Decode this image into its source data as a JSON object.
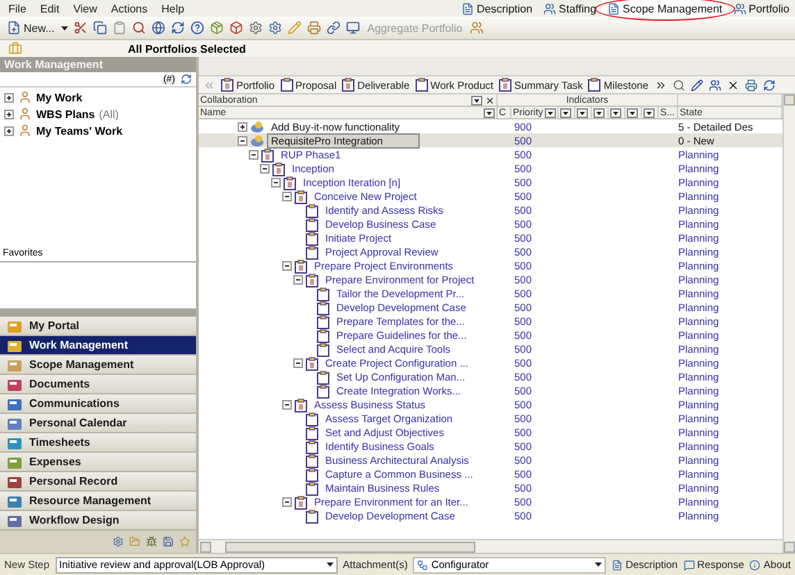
{
  "menu": [
    {
      "label": "File"
    },
    {
      "label": "Edit"
    },
    {
      "label": "View"
    },
    {
      "label": "Actions"
    },
    {
      "label": "Help"
    }
  ],
  "view_tabs": [
    {
      "label": "Description",
      "selected": false,
      "highlighted": false
    },
    {
      "label": "Staffing",
      "selected": false,
      "highlighted": false
    },
    {
      "label": "Scope Management",
      "selected": true,
      "highlighted": true
    },
    {
      "label": "Portfolio",
      "selected": false,
      "highlighted": false
    }
  ],
  "toolbar": {
    "new_button": "New...",
    "aggregate_portfolio": {
      "label": "Aggregate Portfolio",
      "disabled": true
    }
  },
  "portfolio_bar": {
    "title": "All Portfolios Selected"
  },
  "left_panel": {
    "title": "Work Management",
    "count_button": "(#)",
    "tree": [
      {
        "label": "My Work",
        "expanded": false
      },
      {
        "label": "WBS Plans",
        "suffix": "(All)",
        "expanded": false
      },
      {
        "label": "My Teams' Work",
        "expanded": false
      }
    ],
    "favorites_label": "Favorites",
    "nav": [
      {
        "label": "My Portal",
        "selected": false
      },
      {
        "label": "Work Management",
        "selected": true
      },
      {
        "label": "Scope Management",
        "selected": false
      },
      {
        "label": "Documents",
        "selected": false
      },
      {
        "label": "Communications",
        "selected": false
      },
      {
        "label": "Personal Calendar",
        "selected": false
      },
      {
        "label": "Timesheets",
        "selected": false
      },
      {
        "label": "Expenses",
        "selected": false
      },
      {
        "label": "Personal Record",
        "selected": false
      },
      {
        "label": "Resource Management",
        "selected": false
      },
      {
        "label": "Workflow Design",
        "selected": false
      }
    ]
  },
  "work_toolbar": [
    {
      "label": "Portfolio"
    },
    {
      "label": "Proposal"
    },
    {
      "label": "Deliverable"
    },
    {
      "label": "Work Product"
    },
    {
      "label": "Summary Task"
    },
    {
      "label": "Milestone"
    }
  ],
  "grid": {
    "group_headers": [
      "Collaboration",
      "Indicators"
    ],
    "columns": {
      "name": "Name",
      "c": "C",
      "priority": "Priority",
      "s": "S...",
      "state": "State"
    },
    "rows": [
      {
        "name": "Add Buy-it-now functionality",
        "kind": "proposal",
        "priority": "900",
        "state": "5 - Detailed Des",
        "expanded": false,
        "selected": false
      },
      {
        "name": "RequisitePro Integration",
        "kind": "proposal",
        "priority": "500",
        "state": "0 - New",
        "expanded": true,
        "selected": true,
        "children": [
          {
            "name": "RUP Phase1",
            "kind": "summary",
            "priority": "500",
            "state": "Planning",
            "expanded": true,
            "selected": false,
            "children": [
              {
                "name": "Inception",
                "kind": "summary",
                "priority": "500",
                "state": "Planning",
                "expanded": true,
                "selected": false,
                "children": [
                  {
                    "name": "Inception Iteration [n]",
                    "kind": "summary",
                    "priority": "500",
                    "state": "Planning",
                    "expanded": true,
                    "selected": false,
                    "children": [
                      {
                        "name": "Conceive New Project",
                        "kind": "summary",
                        "priority": "500",
                        "state": "Planning",
                        "expanded": true,
                        "selected": false,
                        "children": [
                          {
                            "name": "Identify and Assess Risks",
                            "kind": "task",
                            "priority": "500",
                            "state": "Planning",
                            "selected": false
                          },
                          {
                            "name": "Develop Business Case",
                            "kind": "task",
                            "priority": "500",
                            "state": "Planning",
                            "selected": false
                          },
                          {
                            "name": "Initiate Project",
                            "kind": "task",
                            "priority": "500",
                            "state": "Planning",
                            "selected": false
                          },
                          {
                            "name": "Project Approval Review",
                            "kind": "task",
                            "priority": "500",
                            "state": "Planning",
                            "selected": false
                          }
                        ]
                      },
                      {
                        "name": "Prepare Project Environments",
                        "kind": "summary",
                        "priority": "500",
                        "state": "Planning",
                        "expanded": true,
                        "selected": false,
                        "children": [
                          {
                            "name": "Prepare Environment for Project",
                            "kind": "summary",
                            "priority": "500",
                            "state": "Planning",
                            "expanded": true,
                            "selected": false,
                            "children": [
                              {
                                "name": "Tailor the Development Pr...",
                                "kind": "task",
                                "priority": "500",
                                "state": "Planning",
                                "selected": false
                              },
                              {
                                "name": "Develop Development Case",
                                "kind": "task",
                                "priority": "500",
                                "state": "Planning",
                                "selected": false
                              },
                              {
                                "name": "Prepare Templates for the...",
                                "kind": "task",
                                "priority": "500",
                                "state": "Planning",
                                "selected": false
                              },
                              {
                                "name": "Prepare Guidelines for the...",
                                "kind": "task",
                                "priority": "500",
                                "state": "Planning",
                                "selected": false
                              },
                              {
                                "name": "Select and Acquire Tools",
                                "kind": "task",
                                "priority": "500",
                                "state": "Planning",
                                "selected": false
                              }
                            ]
                          },
                          {
                            "name": "Create Project Configuration ...",
                            "kind": "summary",
                            "priority": "500",
                            "state": "Planning",
                            "expanded": true,
                            "selected": false,
                            "children": [
                              {
                                "name": "Set Up Configuration Man...",
                                "kind": "task",
                                "priority": "500",
                                "state": "Planning",
                                "selected": false
                              },
                              {
                                "name": "Create Integration Works...",
                                "kind": "task",
                                "priority": "500",
                                "state": "Planning",
                                "selected": false
                              }
                            ]
                          }
                        ]
                      },
                      {
                        "name": "Assess Business Status",
                        "kind": "summary",
                        "priority": "500",
                        "state": "Planning",
                        "expanded": true,
                        "selected": false,
                        "children": [
                          {
                            "name": "Assess Target Organization",
                            "kind": "task",
                            "priority": "500",
                            "state": "Planning",
                            "selected": false
                          },
                          {
                            "name": "Set and Adjust Objectives",
                            "kind": "task",
                            "priority": "500",
                            "state": "Planning",
                            "selected": false
                          },
                          {
                            "name": "Identify Business Goals",
                            "kind": "task",
                            "priority": "500",
                            "state": "Planning",
                            "selected": false
                          },
                          {
                            "name": "Business Architectural Analysis",
                            "kind": "task",
                            "priority": "500",
                            "state": "Planning",
                            "selected": false
                          },
                          {
                            "name": "Capture a Common Business ...",
                            "kind": "task",
                            "priority": "500",
                            "state": "Planning",
                            "selected": false
                          },
                          {
                            "name": "Maintain Business Rules",
                            "kind": "task",
                            "priority": "500",
                            "state": "Planning",
                            "selected": false
                          }
                        ]
                      },
                      {
                        "name": "Prepare Environment for an Iter...",
                        "kind": "summary",
                        "priority": "500",
                        "state": "Planning",
                        "expanded": true,
                        "selected": false,
                        "children": [
                          {
                            "name": "Develop Development Case",
                            "kind": "task",
                            "priority": "500",
                            "state": "Planning",
                            "selected": false
                          }
                        ]
                      }
                    ]
                  }
                ]
              }
            ]
          }
        ]
      }
    ]
  },
  "status_bar": {
    "new_step_label": "New Step",
    "new_step_value": "Initiative review and approval(LOB Approval)",
    "attachments": "Attachment(s)",
    "configurator": "Configurator",
    "description": "Description",
    "response": "Response",
    "about": "About"
  }
}
